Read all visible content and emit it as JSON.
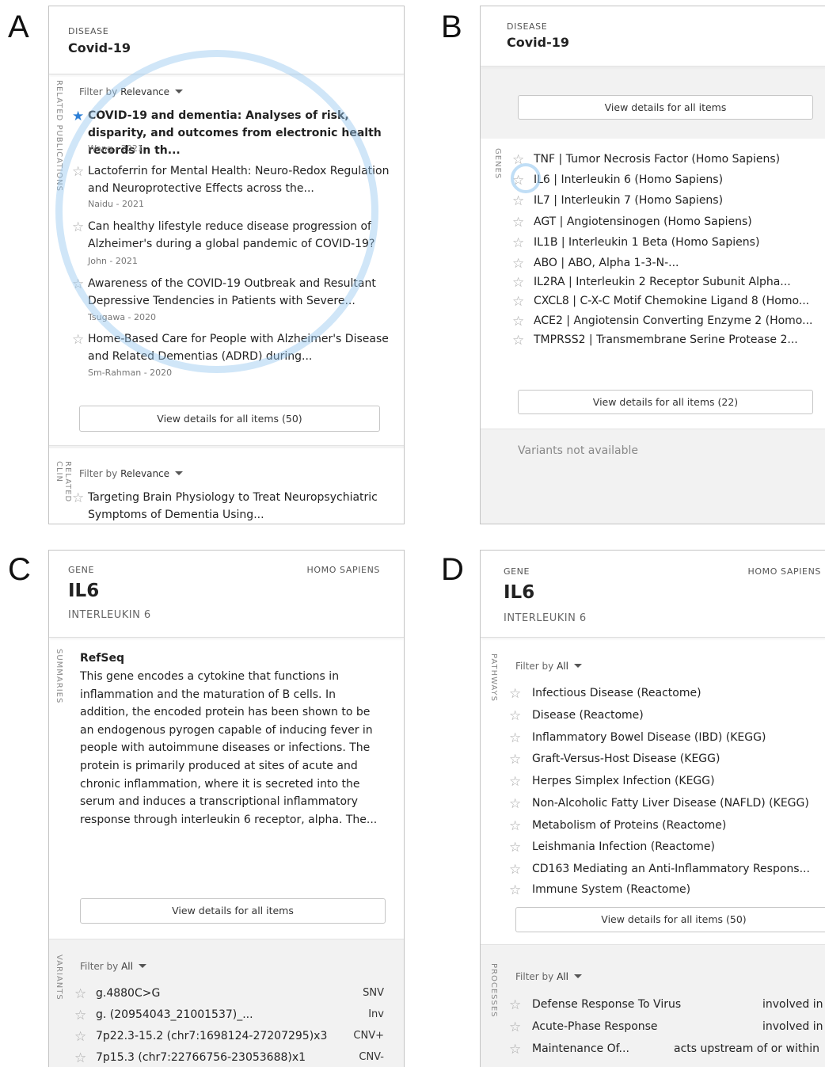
{
  "panel_labels": [
    "A",
    "B",
    "C",
    "D"
  ],
  "panelA": {
    "kind": "DISEASE",
    "title": "Covid-19",
    "section_label": "RELATED PUBLICATIONS",
    "filter": {
      "prefix": "Filter by",
      "value": "Relevance"
    },
    "publications": [
      {
        "title": "COVID-19 and dementia: Analyses of risk, disparity, and outcomes from electronic health records in th...",
        "meta": "Wang - 2021",
        "starred": true
      },
      {
        "title": "Lactoferrin for Mental Health: Neuro-Redox Regulation and Neuroprotective Effects across the...",
        "meta": "Naidu - 2021",
        "starred": false
      },
      {
        "title": "Can healthy lifestyle reduce disease progression of Alzheimer's during a global pandemic of COVID-19?",
        "meta": "John - 2021",
        "starred": false
      },
      {
        "title": "Awareness of the COVID-19 Outbreak and Resultant Depressive Tendencies in Patients with Severe...",
        "meta": "Tsugawa - 2020",
        "starred": false
      },
      {
        "title": "Home-Based Care for People with Alzheimer's Disease and Related Dementias (ADRD) during...",
        "meta": "Sm-Rahman - 2020",
        "starred": false
      }
    ],
    "view_all": "View details for all items (50)",
    "section2_label": "RELATED CLIN",
    "filter2": {
      "prefix": "Filter by",
      "value": "Relevance"
    },
    "trial": {
      "title": "Targeting Brain Physiology to Treat Neuropsychiatric Symptoms of Dementia Using..."
    }
  },
  "panelB": {
    "kind": "DISEASE",
    "title": "Covid-19",
    "view_all_top": "View details for all items",
    "section_label": "GENES",
    "genes": [
      "TNF | Tumor Necrosis Factor (Homo Sapiens)",
      "IL6 | Interleukin 6 (Homo Sapiens)",
      "IL7 | Interleukin 7 (Homo Sapiens)",
      "AGT | Angiotensinogen (Homo Sapiens)",
      "IL1B | Interleukin 1 Beta (Homo Sapiens)",
      "ABO | ABO, Alpha 1-3-N-...",
      "IL2RA | Interleukin 2 Receptor Subunit Alpha...",
      "CXCL8 | C-X-C Motif Chemokine Ligand 8 (Homo...",
      "ACE2 | Angiotensin Converting Enzyme 2 (Homo...",
      "TMPRSS2 | Transmembrane Serine Protease 2..."
    ],
    "view_all": "View details for all items (22)",
    "variants_note": "Variants not available"
  },
  "panelC": {
    "kind": "GENE",
    "species": "HOMO SAPIENS",
    "title": "IL6",
    "subtitle": "INTERLEUKIN 6",
    "section_label": "SUMMARIES",
    "summary_source": "RefSeq",
    "summary_lines": [
      "This gene encodes a cytokine that functions in",
      "inflammation and the maturation of B cells. In",
      "addition, the encoded protein has been shown to be",
      "an endogenous pyrogen capable of inducing fever in",
      "people with autoimmune diseases or infections. The",
      "protein is primarily produced at sites of acute and",
      "chronic inflammation, where it is secreted into the",
      "serum and induces a transcriptional inflammatory",
      "response through interleukin 6 receptor, alpha. The..."
    ],
    "view_all": "View details for all items",
    "section2_label": "VARIANTS",
    "filter": {
      "prefix": "Filter by",
      "value": "All"
    },
    "variants": [
      {
        "name": "g.4880C>G",
        "type": "SNV"
      },
      {
        "name": "g. (20954043_21001537)_...",
        "type": "Inv"
      },
      {
        "name": "7p22.3-15.2 (chr7:1698124-27207295)x3",
        "type": "CNV+"
      },
      {
        "name": "7p15.3 (chr7:22766756-23053688)x1",
        "type": "CNV-"
      }
    ]
  },
  "panelD": {
    "kind": "GENE",
    "species": "HOMO SAPIENS",
    "title": "IL6",
    "subtitle": "INTERLEUKIN 6",
    "section_label": "PATHWAYS",
    "filter": {
      "prefix": "Filter by",
      "value": "All"
    },
    "pathways": [
      "Infectious Disease (Reactome)",
      "Disease (Reactome)",
      "Inflammatory Bowel Disease (IBD) (KEGG)",
      "Graft-Versus-Host Disease (KEGG)",
      "Herpes Simplex Infection (KEGG)",
      "Non-Alcoholic Fatty Liver Disease (NAFLD) (KEGG)",
      "Metabolism of Proteins (Reactome)",
      "Leishmania Infection (Reactome)",
      "CD163 Mediating an Anti-Inflammatory Respons...",
      "Immune System (Reactome)"
    ],
    "view_all": "View details for all items (50)",
    "section2_label": "PROCESSES",
    "filter2": {
      "prefix": "Filter by",
      "value": "All"
    },
    "processes": [
      {
        "name": "Defense Response To Virus",
        "relation": "involved in"
      },
      {
        "name": "Acute-Phase Response",
        "relation": "involved in"
      },
      {
        "name": "Maintenance Of...",
        "relation": "acts upstream of or within"
      }
    ]
  }
}
